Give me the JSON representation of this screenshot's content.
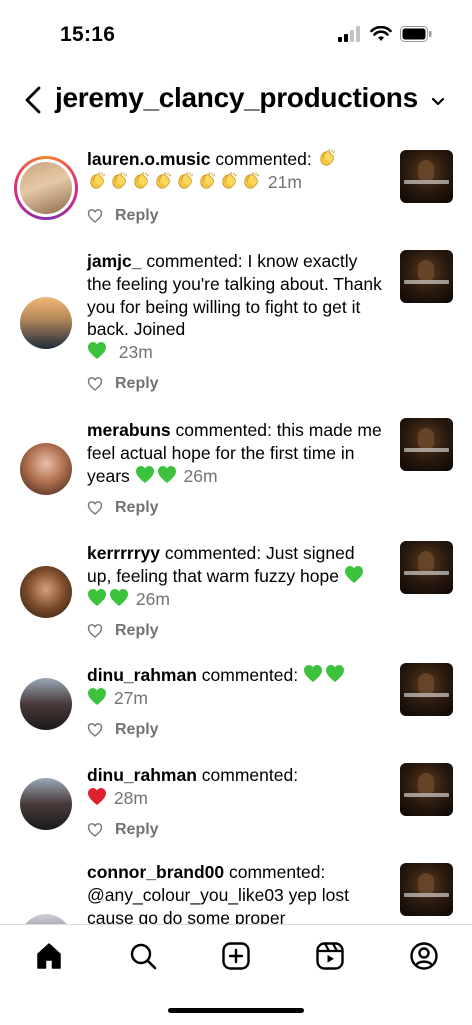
{
  "status_bar": {
    "time": "15:16"
  },
  "header": {
    "title": "jeremy_clancy_productions"
  },
  "comments": [
    {
      "username": "lauren.o.music",
      "verb": "commented:",
      "text": "",
      "emojis_inline": 1,
      "emojis_line2": 8,
      "emoji": "clap",
      "time": "21m",
      "reply": "Reply"
    },
    {
      "username": "jamjc_",
      "verb": "commented:",
      "text": "I know exactly the feeling you're talking about. Thank you for being willing to fight to get it back. Joined",
      "emoji": "green-heart",
      "time": "23m",
      "reply": "Reply"
    },
    {
      "username": "merabuns",
      "verb": "commented:",
      "text": "this made me feel actual hope for the first time in years",
      "emoji": "green-heart",
      "time": "26m",
      "reply": "Reply"
    },
    {
      "username": "kerrrrryy",
      "verb": "commented:",
      "text": "Just signed up, feeling that warm fuzzy hope",
      "emoji": "green-heart",
      "time": "26m",
      "reply": "Reply"
    },
    {
      "username": "dinu_rahman",
      "verb": "commented:",
      "text": "",
      "emoji": "green-heart",
      "time": "27m",
      "reply": "Reply"
    },
    {
      "username": "dinu_rahman",
      "verb": "commented:",
      "text": "",
      "emoji": "red-heart",
      "time": "28m",
      "reply": "Reply"
    },
    {
      "username": "connor_brand00",
      "verb": "commented:",
      "text": "@any_colour_you_like03 yep lost cause go do some proper"
    }
  ],
  "colors": {
    "green_heart": "#3cc23c",
    "red_heart": "#e0202e",
    "secondary_text": "#737373"
  },
  "nav": [
    "home-icon",
    "search-icon",
    "create-icon",
    "reels-icon",
    "profile-icon"
  ]
}
